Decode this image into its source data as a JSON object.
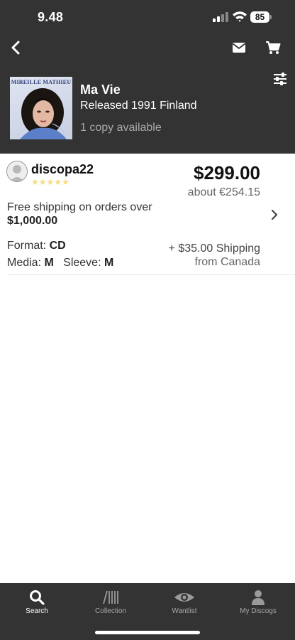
{
  "status_bar": {
    "time": "9.48",
    "battery": "85"
  },
  "nav": {
    "back_icon": "chevron-left-icon",
    "mail_icon": "envelope-icon",
    "cart_icon": "cart-icon",
    "filter_icon": "sliders-icon"
  },
  "release": {
    "cover_brand": "MIREILLE MATHIEU",
    "title": "Ma Vie",
    "subtitle": "Released 1991 Finland",
    "copies": "1 copy available"
  },
  "listing": {
    "seller": "discopa22",
    "rating_stars": "★★★★★",
    "price": "$299.00",
    "price_converted": "about €254.15",
    "shipping_note": "Free shipping on orders over",
    "shipping_threshold": "$1,000.00",
    "format_label": "Format:",
    "format_value": "CD",
    "media_label": "Media:",
    "media_value": "M",
    "sleeve_label": "Sleeve:",
    "sleeve_value": "M",
    "shipping_cost": "+ $35.00 Shipping",
    "ships_from": "from Canada"
  },
  "tabs": [
    {
      "label": "Search",
      "icon": "search-icon",
      "active": true
    },
    {
      "label": "Collection",
      "icon": "collection-icon",
      "active": false
    },
    {
      "label": "Wantlist",
      "icon": "eye-icon",
      "active": false
    },
    {
      "label": "My Discogs",
      "icon": "user-icon",
      "active": false
    }
  ],
  "colors": {
    "header_bg": "#333333",
    "star": "#f7dd7a",
    "tab_active": "#ffffff",
    "tab_inactive": "#a9a9a9"
  }
}
